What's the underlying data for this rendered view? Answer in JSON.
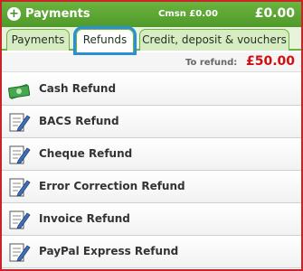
{
  "header": {
    "title": "Payments",
    "commission": "Cmsn £0.00",
    "total": "£0.00"
  },
  "tabs": [
    {
      "label": "Payments",
      "active": false
    },
    {
      "label": "Refunds",
      "active": true
    },
    {
      "label": "Credit, deposit & vouchers",
      "active": false
    }
  ],
  "refund_summary": {
    "label": "To refund:",
    "value": "£50.00"
  },
  "refund_options": [
    {
      "label": "Cash Refund",
      "icon": "cash-icon"
    },
    {
      "label": "BACS Refund",
      "icon": "edit-document-icon"
    },
    {
      "label": "Cheque Refund",
      "icon": "edit-document-icon"
    },
    {
      "label": "Error Correction Refund",
      "icon": "edit-document-icon"
    },
    {
      "label": "Invoice Refund",
      "icon": "edit-document-icon"
    },
    {
      "label": "PayPal Express Refund",
      "icon": "edit-document-icon"
    }
  ],
  "colors": {
    "header_green": "#5ea733",
    "active_tab_outline": "#2b8fd4",
    "refund_red": "#d01010",
    "panel_border": "#c8242a"
  }
}
